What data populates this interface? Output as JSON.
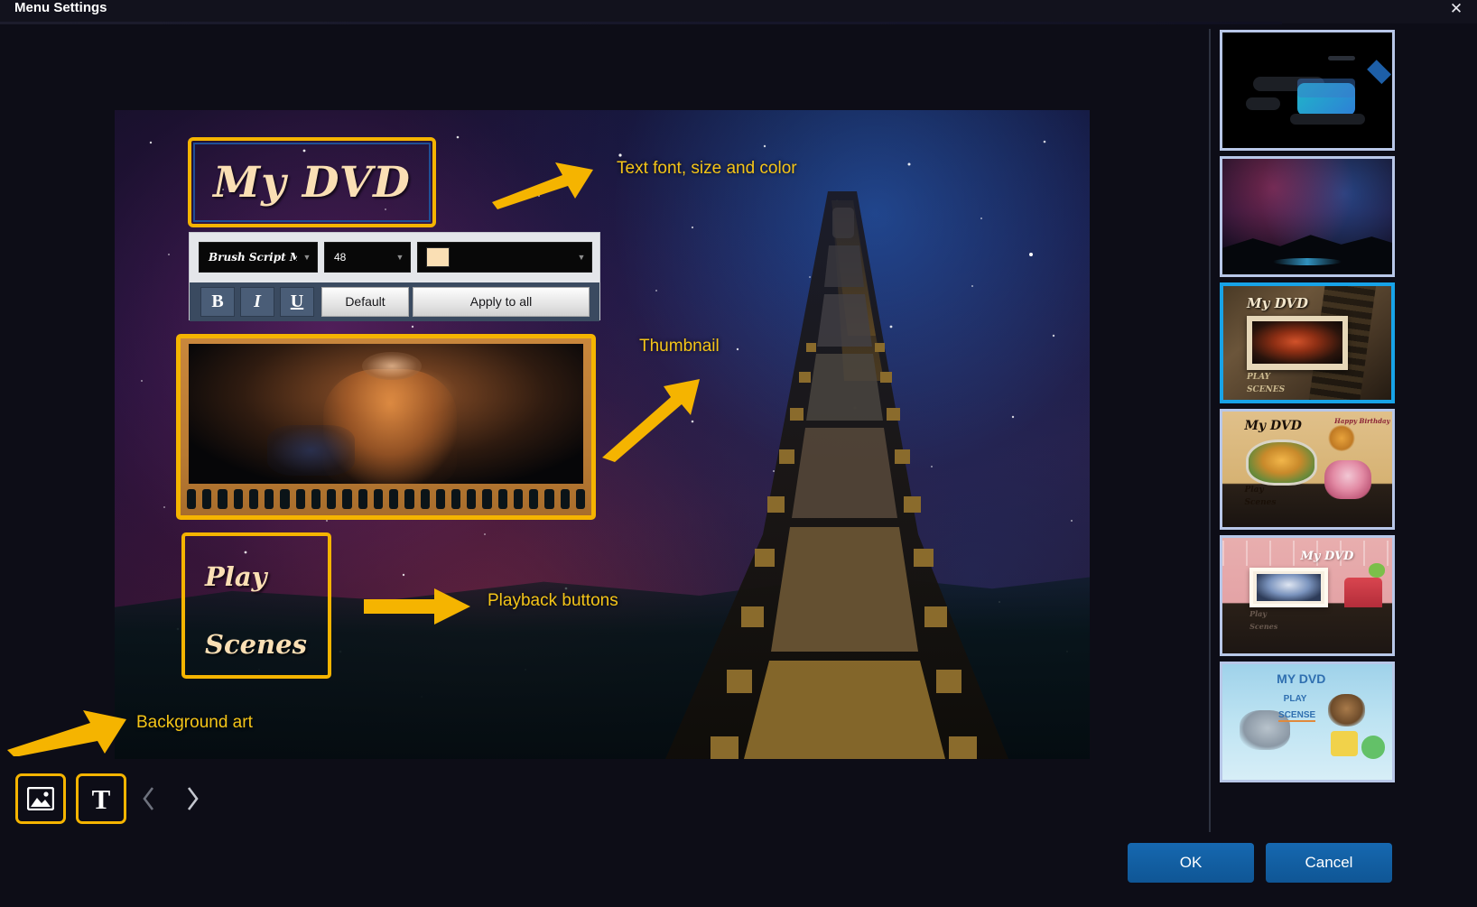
{
  "window": {
    "title": "Menu Settings",
    "close_icon": "close-icon"
  },
  "menu_preview": {
    "title_text": "My DVD",
    "play_label": "Play",
    "scenes_label": "Scenes"
  },
  "font_toolbar": {
    "font_family_value": "Brush Script MT",
    "font_size_value": "48",
    "font_color_swatch": "#fadfb4",
    "dropdown_icon": "chevron-down-icon",
    "bold_label": "B",
    "italic_label": "I",
    "underline_label": "U",
    "default_label": "Default",
    "apply_all_label": "Apply to all"
  },
  "annotations": [
    {
      "id": "font",
      "text": "Text font, size and color"
    },
    {
      "id": "thumbnail",
      "text": "Thumbnail"
    },
    {
      "id": "playback",
      "text": "Playback buttons"
    },
    {
      "id": "background",
      "text": "Background art"
    }
  ],
  "bottom_toolbar": {
    "image_button_icon": "image-icon",
    "text_button_icon": "text-t-icon",
    "prev_icon": "chevron-left-icon",
    "next_icon": "chevron-right-icon"
  },
  "templates": [
    {
      "index": 1,
      "name": "dark-projector",
      "selected": false,
      "title": "",
      "play": "",
      "scenes": ""
    },
    {
      "index": 2,
      "name": "night-sky-mountain",
      "selected": false,
      "title": "",
      "play": "",
      "scenes": ""
    },
    {
      "index": 3,
      "name": "vintage-film-sepia",
      "selected": true,
      "title": "My DVD",
      "play": "PLAY",
      "scenes": "SCENES"
    },
    {
      "index": 4,
      "name": "birthday-cake-kraft",
      "selected": false,
      "title": "My DVD",
      "play": "Play",
      "scenes": "Scenes",
      "extra": "Happy Birthday"
    },
    {
      "index": 5,
      "name": "pink-wedding-lights",
      "selected": false,
      "title": "My DVD",
      "play": "Play",
      "scenes": "Scenes"
    },
    {
      "index": 6,
      "name": "kids-rainbow-cartoon",
      "selected": false,
      "title": "MY DVD",
      "play": "PLAY",
      "scenes": "SCENSE"
    }
  ],
  "dialog_buttons": {
    "ok_label": "OK",
    "cancel_label": "Cancel"
  },
  "colors": {
    "accent_yellow": "#f5b400",
    "annotation_yellow": "#f5c518",
    "selection_blue": "#17a3e8",
    "thumb_border_blue": "#b8c7e8",
    "dialog_blue": "#0f5695",
    "text_cream": "#fadfb4"
  }
}
